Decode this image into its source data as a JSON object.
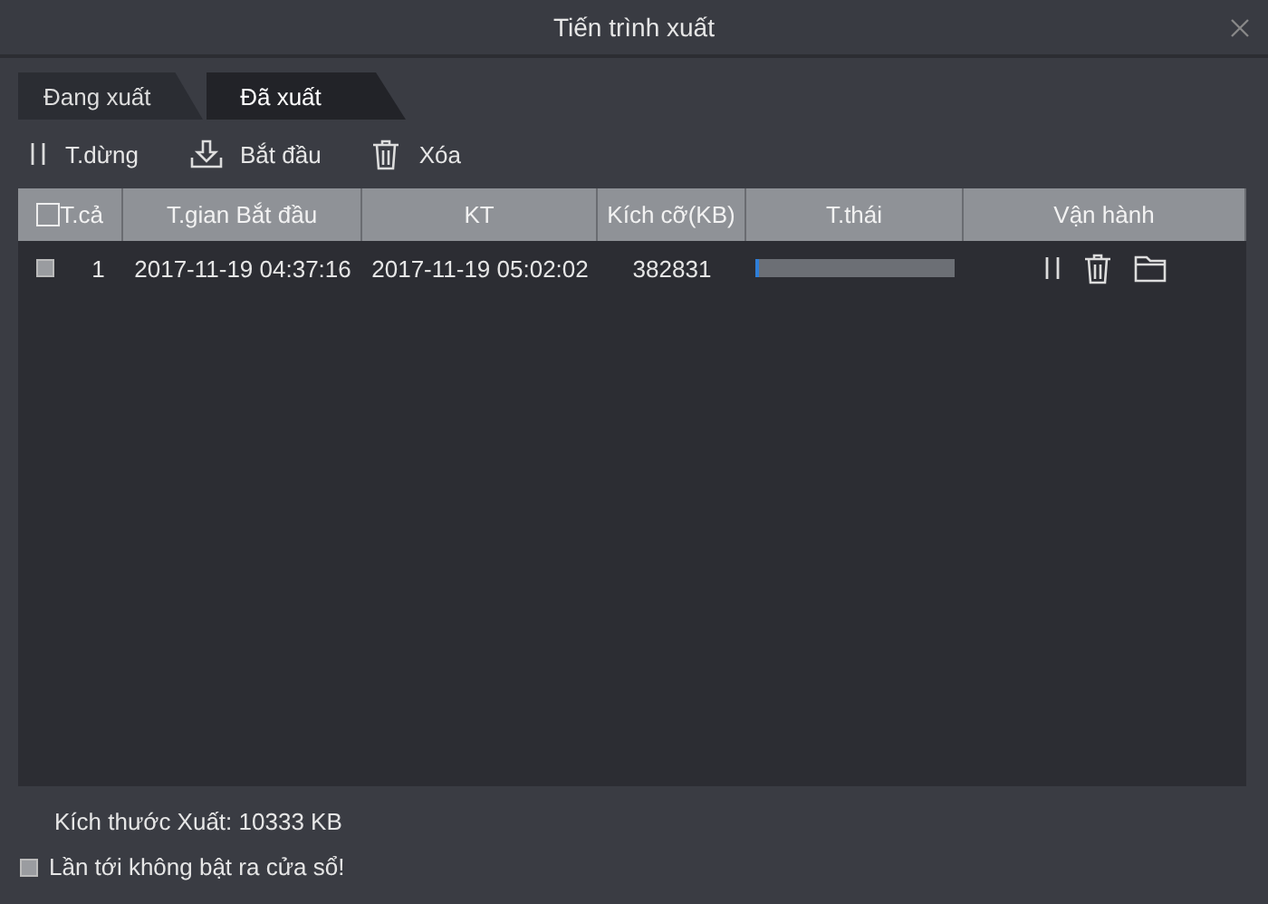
{
  "window": {
    "title": "Tiến trình xuất"
  },
  "tabs": [
    {
      "label": "Đang xuất",
      "selected": false
    },
    {
      "label": "Đã xuất",
      "selected": true
    }
  ],
  "toolbar": [
    {
      "kind": "pause",
      "label": "T.dừng"
    },
    {
      "kind": "download",
      "label": "Bắt đầu"
    },
    {
      "kind": "delete",
      "label": "Xóa"
    }
  ],
  "table": {
    "select_all": {
      "checked": false
    },
    "columns": [
      "T.cả",
      "T.gian Bắt đầu",
      "KT",
      "Kích cỡ(KB)",
      "T.thái",
      "Vận hành"
    ],
    "rows": [
      {
        "checked": false,
        "index": "1",
        "start": "2017-11-19 04:37:16",
        "end": "2017-11-19 05:02:02",
        "size": "382831",
        "level": 0.02,
        "actions": [
          {
            "kind": "pause"
          },
          {
            "kind": "delete"
          },
          {
            "kind": "folder"
          }
        ]
      }
    ]
  },
  "export_size": "Kích thước Xuất: 10333 KB",
  "dont_show": {
    "label": "Lần tới không bật ra cửa sổ!",
    "checked": false
  }
}
